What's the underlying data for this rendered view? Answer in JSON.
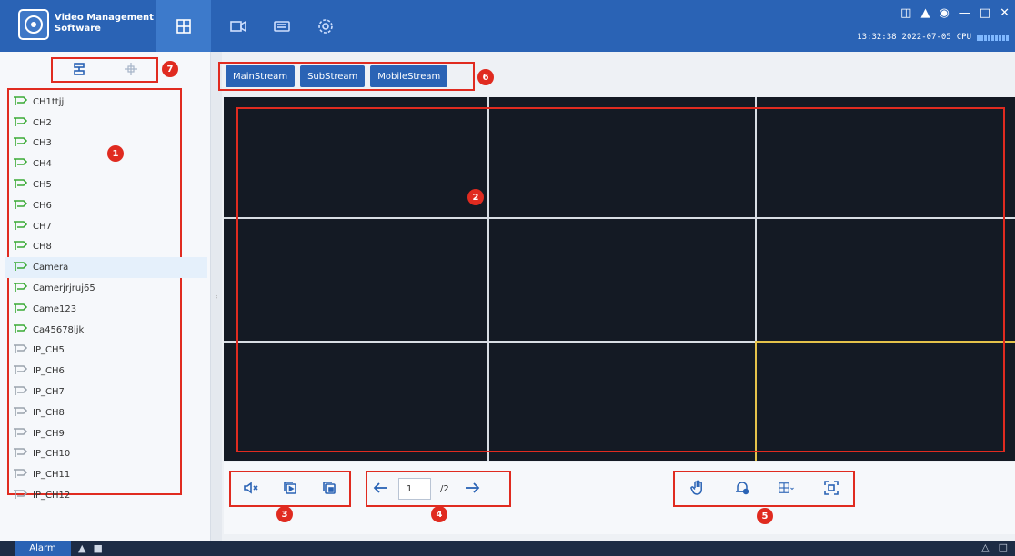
{
  "app": {
    "title_line1": "Video Management",
    "title_line2": "Software"
  },
  "status": {
    "time": "13:32:38",
    "date": "2022-07-05",
    "cpu_label": "CPU"
  },
  "channels": [
    {
      "label": "CH1ttjj",
      "online": true
    },
    {
      "label": "CH2",
      "online": true
    },
    {
      "label": "CH3",
      "online": true
    },
    {
      "label": "CH4",
      "online": true
    },
    {
      "label": "CH5",
      "online": true
    },
    {
      "label": "CH6",
      "online": true
    },
    {
      "label": "CH7",
      "online": true
    },
    {
      "label": "CH8",
      "online": true
    },
    {
      "label": "Camera",
      "online": true,
      "selected": true
    },
    {
      "label": "Camerjrjruj65",
      "online": true
    },
    {
      "label": "Came123",
      "online": true
    },
    {
      "label": "Ca45678ijk",
      "online": true
    },
    {
      "label": "IP_CH5",
      "online": false
    },
    {
      "label": "IP_CH6",
      "online": false
    },
    {
      "label": "IP_CH7",
      "online": false
    },
    {
      "label": "IP_CH8",
      "online": false
    },
    {
      "label": "IP_CH9",
      "online": false
    },
    {
      "label": "IP_CH10",
      "online": false
    },
    {
      "label": "IP_CH11",
      "online": false
    },
    {
      "label": "IP_CH12",
      "online": false
    }
  ],
  "streams": {
    "main": "MainStream",
    "sub": "SubStream",
    "mobile": "MobileStream"
  },
  "pagination": {
    "current": "1",
    "total": "/2"
  },
  "statusbar": {
    "alarm_label": "Alarm"
  },
  "markers": [
    "1",
    "2",
    "3",
    "4",
    "5",
    "6",
    "7"
  ],
  "colors": {
    "accent": "#2a63b5",
    "annotation": "#e02b20",
    "online_icon": "#3aaa35",
    "offline_icon": "#9aa3ad"
  }
}
